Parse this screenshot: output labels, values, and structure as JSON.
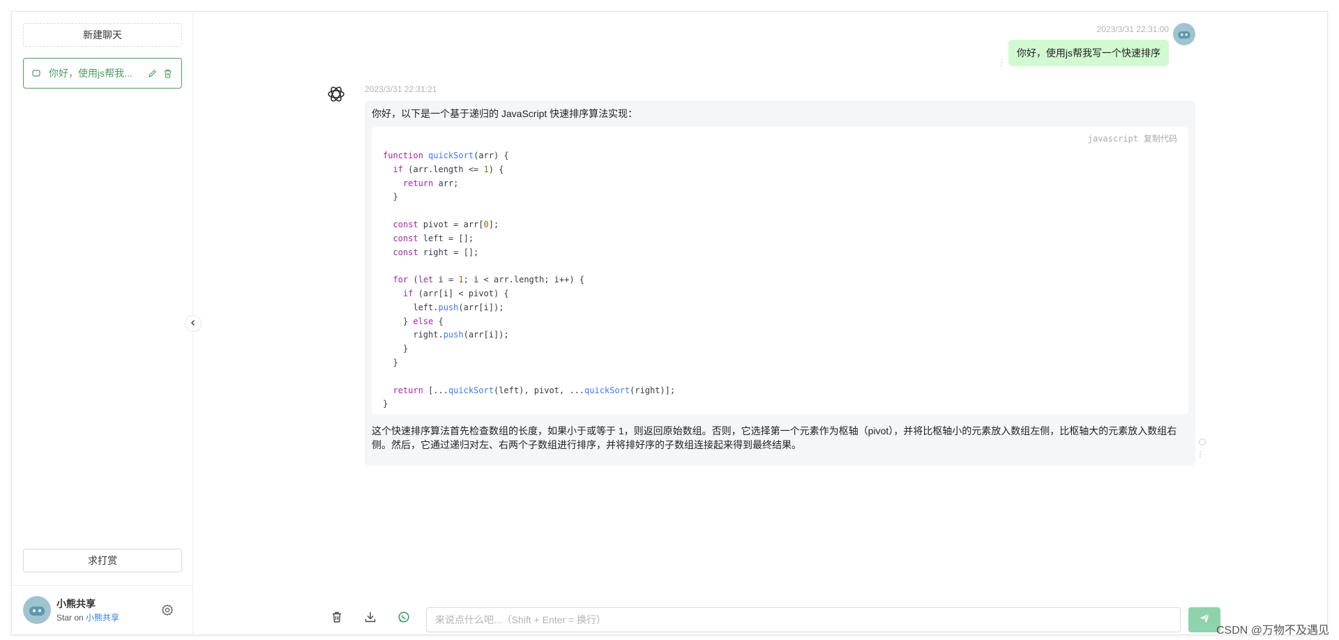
{
  "sidebar": {
    "new_chat_label": "新建聊天",
    "history": [
      {
        "label": "你好，使用js帮我..."
      }
    ],
    "reward_label": "求打赏",
    "user": {
      "name": "小熊共享",
      "sub_prefix": "Star on ",
      "sub_link": "小熊共享"
    }
  },
  "messages": {
    "user": {
      "time": "2023/3/31 22:31:00",
      "text": "你好，使用js帮我写一个快速排序"
    },
    "assistant": {
      "time": "2023/3/31 22:31:21",
      "intro": "你好，以下是一个基于递归的 JavaScript 快速排序算法实现：",
      "code_lang": "javascript",
      "copy_label": "复制代码",
      "outro": "这个快速排序算法首先检查数组的长度，如果小于或等于 1，则返回原始数组。否则，它选择第一个元素作为枢轴（pivot），并将比枢轴小的元素放入数组左侧，比枢轴大的元素放入数组右侧。然后，它通过递归对左、右两个子数组进行排序，并将排好序的子数组连接起来得到最终结果。"
    }
  },
  "composer": {
    "placeholder": "来说点什么吧...（Shift + Enter = 换行）"
  },
  "watermark": "CSDN @万物不及遇见",
  "colors": {
    "accent": "#4b9e5f",
    "user_bubble": "#d2f9d1",
    "send_button": "#8fd3ad",
    "link": "#2f7ee6"
  }
}
